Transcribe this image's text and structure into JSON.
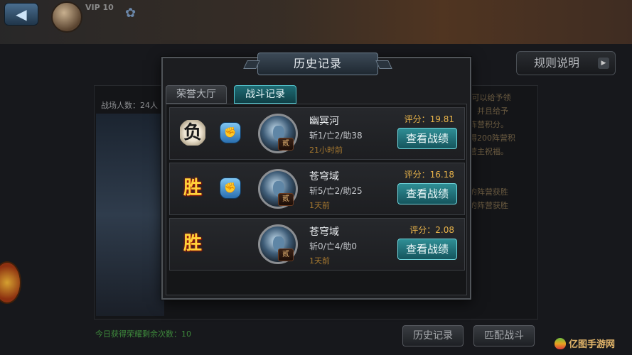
{
  "background": {
    "vip": "VIP 10",
    "rules_button": "规则说明",
    "participants": "战场人数：24人",
    "remaining_label": "今日获得荣耀剩余次数：10",
    "history_button": "历史记录",
    "match_button": "匹配战斗",
    "side_texts": [
      ",可以给予领",
      "，并且给予",
      "阵营积分。",
      "得200阵营积",
      "营主祝福。",
      "的阵营获胜",
      "的阵营获胜"
    ],
    "watermark": "亿图手游网"
  },
  "modal": {
    "title": "历史记录",
    "tabs": [
      {
        "label": "荣誉大厅",
        "active": false
      },
      {
        "label": "战斗记录",
        "active": true
      }
    ],
    "records": [
      {
        "result": "负",
        "outcome": "lose",
        "name": "幽冥河",
        "kda": "斩1/亡2/助38",
        "time": "21小时前",
        "score": "评分：19.81",
        "badge": "贰",
        "button": "查看战绩",
        "show_fist": true
      },
      {
        "result": "胜",
        "outcome": "win",
        "name": "苍穹域",
        "kda": "斩5/亡2/助25",
        "time": "1天前",
        "score": "评分：16.18",
        "badge": "贰",
        "button": "查看战绩",
        "show_fist": true
      },
      {
        "result": "胜",
        "outcome": "win",
        "name": "苍穹域",
        "kda": "斩0/亡4/助0",
        "time": "1天前",
        "score": "评分：2.08",
        "badge": "贰",
        "button": "查看战绩",
        "show_fist": false
      }
    ]
  }
}
